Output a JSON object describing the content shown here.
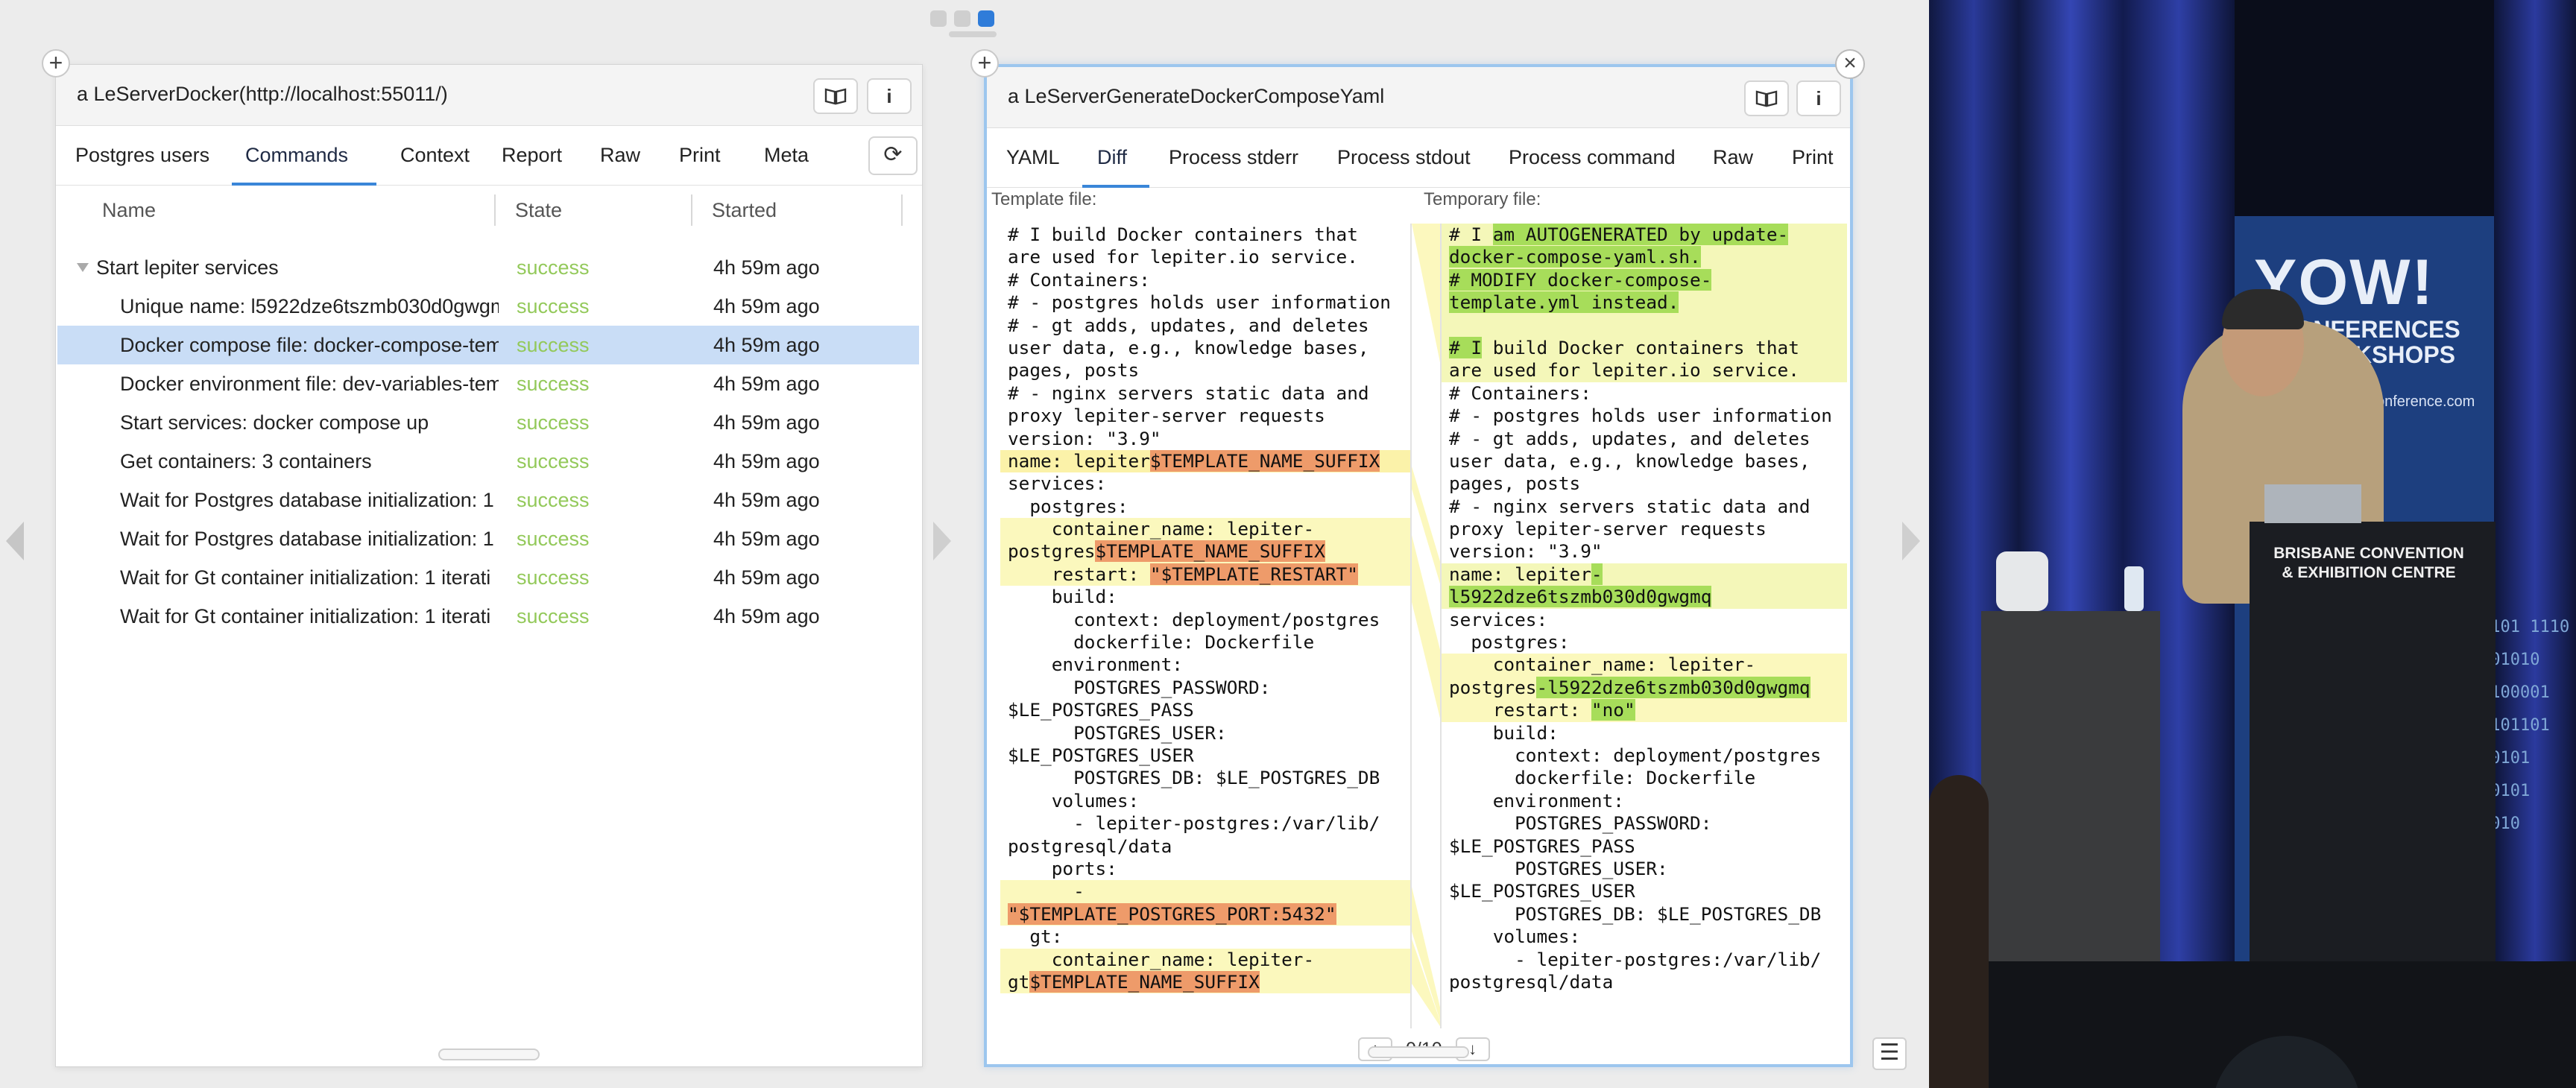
{
  "left_pane": {
    "title": "a LeServerDocker(http://localhost:55011/)",
    "book_icon": "book-icon",
    "info_icon": "i",
    "refresh_icon": "⟳",
    "tabs": [
      "Postgres users",
      "Commands",
      "Context",
      "Report",
      "Raw",
      "Print",
      "Meta"
    ],
    "active_tab": "Commands",
    "columns": [
      "Name",
      "State",
      "Started"
    ],
    "rows": [
      {
        "name": "Start lepiter services",
        "state": "success",
        "started": "4h 59m ago"
      },
      {
        "name": "Unique name: l5922dze6tszmb030d0gwgm",
        "state": "success",
        "started": "4h 59m ago"
      },
      {
        "name": "Docker compose file: docker-compose-tem",
        "state": "success",
        "started": "4h 59m ago"
      },
      {
        "name": "Docker environment file: dev-variables-tem",
        "state": "success",
        "started": "4h 59m ago"
      },
      {
        "name": "Start services: docker compose up",
        "state": "success",
        "started": "4h 59m ago"
      },
      {
        "name": "Get containers: 3 containers",
        "state": "success",
        "started": "4h 59m ago"
      },
      {
        "name": "Wait for Postgres database initialization: 1 i",
        "state": "success",
        "started": "4h 59m ago"
      },
      {
        "name": "Wait for Postgres database initialization: 1 i",
        "state": "success",
        "started": "4h 59m ago"
      },
      {
        "name": "Wait for Gt container initialization: 1 iterati",
        "state": "success",
        "started": "4h 59m ago"
      },
      {
        "name": "Wait for Gt container initialization: 1 iterati",
        "state": "success",
        "started": "4h 59m ago"
      }
    ]
  },
  "right_pane": {
    "title": "a LeServerGenerateDockerComposeYaml",
    "tabs": [
      "YAML",
      "Diff",
      "Process stderr",
      "Process stdout",
      "Process command",
      "Raw",
      "Print"
    ],
    "active_tab": "Diff",
    "template_label": "Template file:",
    "temporary_label": "Temporary file:",
    "template_lines": [
      "# I build Docker containers that",
      "are used for lepiter.io service.",
      "# Containers:",
      "# - postgres holds user information",
      "# - gt adds, updates, and deletes",
      "user data, e.g., knowledge bases,",
      "pages, posts",
      "# - nginx servers static data and",
      "proxy lepiter-server requests",
      "version: \"3.9\"",
      "name: lepiter$TEMPLATE_NAME_SUFFIX",
      "services:",
      "  postgres:",
      "    container_name: lepiter-",
      "postgres$TEMPLATE_NAME_SUFFIX",
      "    restart: \"$TEMPLATE_RESTART\"",
      "    build:",
      "      context: deployment/postgres",
      "      dockerfile: Dockerfile",
      "    environment:",
      "      POSTGRES_PASSWORD:",
      "$LE_POSTGRES_PASS",
      "      POSTGRES_USER:",
      "$LE_POSTGRES_USER",
      "      POSTGRES_DB: $LE_POSTGRES_DB",
      "    volumes:",
      "      - lepiter-postgres:/var/lib/",
      "postgresql/data",
      "    ports:",
      "      -",
      "\"$TEMPLATE_POSTGRES_PORT:5432\"",
      "  gt:",
      "    container_name: lepiter-",
      "gt$TEMPLATE_NAME_SUFFIX"
    ],
    "temporary_lines": [
      "# I am AUTOGENERATED by update-",
      "docker-compose-yaml.sh.",
      "# MODIFY docker-compose-",
      "template.yml instead.",
      "",
      "# I build Docker containers that",
      "are used for lepiter.io service.",
      "# Containers:",
      "# - postgres holds user information",
      "# - gt adds, updates, and deletes",
      "user data, e.g., knowledge bases,",
      "pages, posts",
      "# - nginx servers static data and",
      "proxy lepiter-server requests",
      "version: \"3.9\"",
      "name: lepiter-",
      "l5922dze6tszmb030d0gwgmq",
      "services:",
      "  postgres:",
      "    container_name: lepiter-",
      "postgres-l5922dze6tszmb030d0gwgmq",
      "    restart: \"no\"",
      "    build:",
      "      context: deployment/postgres",
      "      dockerfile: Dockerfile",
      "    environment:",
      "      POSTGRES_PASSWORD:",
      "$LE_POSTGRES_PASS",
      "      POSTGRES_USER:",
      "$LE_POSTGRES_USER",
      "      POSTGRES_DB: $LE_POSTGRES_DB",
      "    volumes:",
      "      - lepiter-postgres:/var/lib/",
      "postgresql/data"
    ],
    "diff_counter": "0/10",
    "prev_icon": "↑",
    "next_icon": "↓"
  },
  "menu_icon": "☰",
  "video": {
    "banner_logo": "YOW!",
    "banner_sub": "CONFERENCES\n+WORKSHOPS",
    "banner_url": "conference.com",
    "podium_sign": "BRISBANE CONVENTION\n& EXHIBITION CENTRE",
    "binary": "0101 1110\n001010\n1100001\n0101101\n10101\n00101\n1010"
  },
  "colors": {
    "accent": "#3a86d8",
    "success": "#93c95a",
    "selected_row": "#c9ddf6",
    "diff_deleted": "#ee9b6a",
    "diff_added": "#a7dd5a",
    "diff_block": "#fbf8bd"
  }
}
